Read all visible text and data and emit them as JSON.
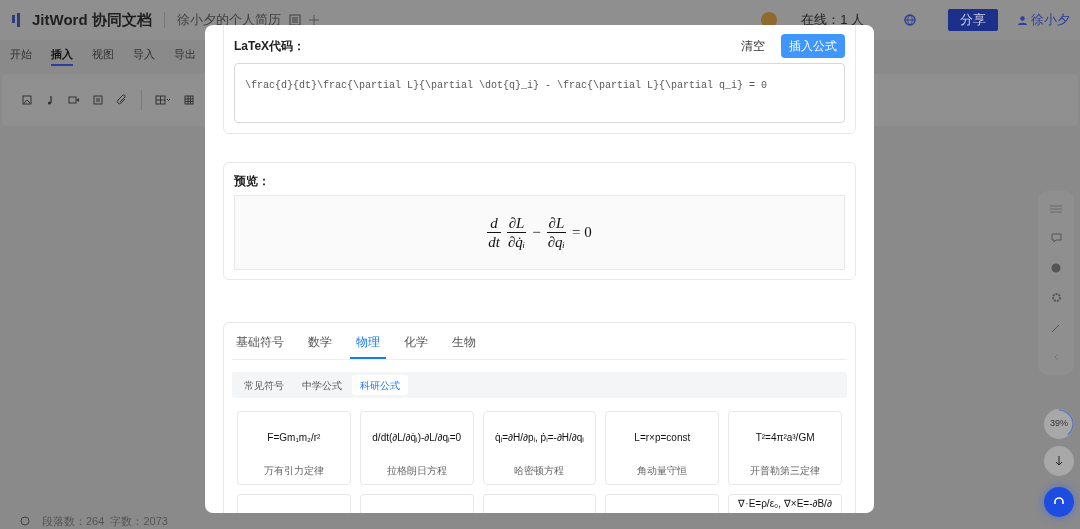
{
  "app": {
    "name": "JitWord 协同文档",
    "document": "徐小夕的个人简历",
    "online": "在线：1 人",
    "share": "分享",
    "user": "徐小夕"
  },
  "menu_tabs": [
    {
      "label": "开始",
      "selected": false
    },
    {
      "label": "插入",
      "selected": true
    },
    {
      "label": "视图",
      "selected": false
    },
    {
      "label": "导入",
      "selected": false
    },
    {
      "label": "导出",
      "selected": false
    }
  ],
  "progress": {
    "text": "39%",
    "level": 0.39
  },
  "status_bar": "段落数：264  字数：2073",
  "dialog": {
    "latex_label": "LaTeX代码：",
    "clear": "清空",
    "insert": "插入公式",
    "latex_code": "\\frac{d}{dt}\\frac{\\partial L}{\\partial \\dot{q}_i} - \\frac{\\partial L}{\\partial q_i} = 0",
    "preview_label": "预览：",
    "preview": [
      {
        "kind": "frac",
        "num": "d",
        "den": "dt"
      },
      {
        "kind": "frac",
        "num": "∂L",
        "den": "∂q̇ᵢ"
      },
      {
        "kind": "op",
        "text": "−"
      },
      {
        "kind": "frac",
        "num": "∂L",
        "den": "∂qᵢ"
      },
      {
        "kind": "op",
        "text": "= 0"
      }
    ],
    "categories": [
      {
        "label": "基础符号",
        "selected": false
      },
      {
        "label": "数学",
        "selected": false
      },
      {
        "label": "物理",
        "selected": true
      },
      {
        "label": "化学",
        "selected": false
      },
      {
        "label": "生物",
        "selected": false
      }
    ],
    "subcategories": [
      {
        "label": "常见符号",
        "selected": false
      },
      {
        "label": "中学公式",
        "selected": false
      },
      {
        "label": "科研公式",
        "selected": true
      }
    ],
    "formulas": [
      {
        "kind": "full",
        "formula": "F=Gm₁m₂/r²",
        "name": "万有引力定律"
      },
      {
        "kind": "full",
        "formula": "d/dt(∂L/∂q̇ᵢ)-∂L/∂qᵢ=0",
        "name": "拉格朗日方程"
      },
      {
        "kind": "full",
        "formula": "q̇ᵢ=∂H/∂pᵢ, ṗᵢ=-∂H/∂qᵢ",
        "name": "哈密顿方程"
      },
      {
        "kind": "full",
        "formula": "L=r×p=const",
        "name": "角动量守恒"
      },
      {
        "kind": "full",
        "formula": "T²=4π²a³/GM",
        "name": "开普勒第三定律"
      },
      {
        "kind": "clipped"
      },
      {
        "kind": "clipped"
      },
      {
        "kind": "clipped"
      },
      {
        "kind": "clipped"
      },
      {
        "kind": "clipped",
        "formula": "∇·E=ρ/ε₀, ∇×E=-∂B/∂"
      }
    ]
  }
}
